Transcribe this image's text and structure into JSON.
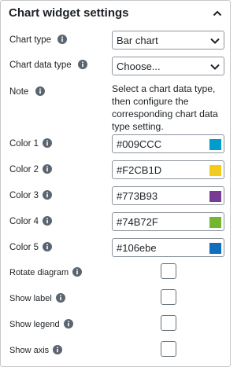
{
  "panel": {
    "title": "Chart widget settings",
    "collapse_icon": "chevron-up-icon"
  },
  "fields": {
    "chart_type": {
      "label": "Chart type",
      "value": "Bar chart"
    },
    "chart_data_type": {
      "label": "Chart data type",
      "value": "Choose..."
    },
    "note": {
      "label": "Note",
      "text": "Select a chart data type, then configure the corresponding chart data type setting."
    },
    "colors": [
      {
        "label": "Color 1",
        "value": "#009CCC",
        "swatch": "#009CCC"
      },
      {
        "label": "Color 2",
        "value": "#F2CB1D",
        "swatch": "#F2CB1D"
      },
      {
        "label": "Color 3",
        "value": "#773B93",
        "swatch": "#773B93"
      },
      {
        "label": "Color 4",
        "value": "#74B72F",
        "swatch": "#74B72F"
      },
      {
        "label": "Color 5",
        "value": "#106ebe",
        "swatch": "#106ebe"
      }
    ],
    "checkboxes": [
      {
        "label": "Rotate diagram",
        "checked": false
      },
      {
        "label": "Show label",
        "checked": false
      },
      {
        "label": "Show legend",
        "checked": false
      },
      {
        "label": "Show axis",
        "checked": false
      }
    ]
  },
  "icons": {
    "info": "info-circle-icon",
    "dropdown": "chevron-down-icon"
  }
}
